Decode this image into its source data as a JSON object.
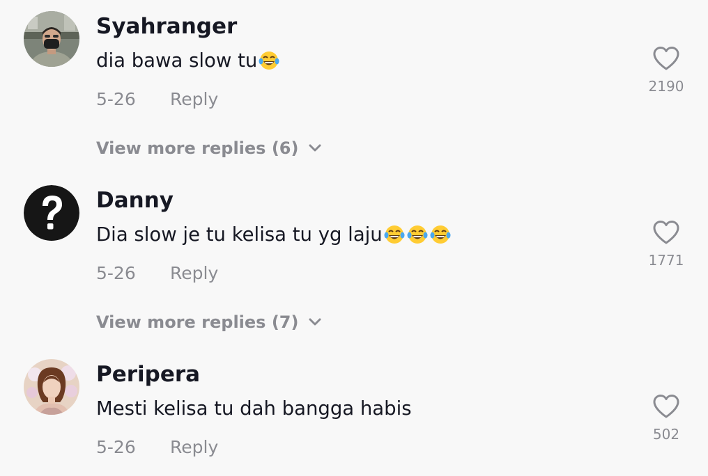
{
  "comments": [
    {
      "username": "Syahranger",
      "text": "dia bawa slow tu",
      "emoji_count": 1,
      "emoji_icon": "face-with-tears-of-joy-icon",
      "date": "5-26",
      "reply_label": "Reply",
      "likes": "2190",
      "view_more_label": "View more replies (6)"
    },
    {
      "username": "Danny",
      "text": "Dia slow je tu kelisa tu yg laju",
      "emoji_count": 3,
      "emoji_icon": "face-with-tears-of-joy-icon",
      "date": "5-26",
      "reply_label": "Reply",
      "likes": "1771",
      "view_more_label": "View more replies (7)"
    },
    {
      "username": "Peripera",
      "text": "Mesti kelisa tu dah bangga habis",
      "emoji_count": 0,
      "date": "5-26",
      "reply_label": "Reply",
      "likes": "502"
    }
  ],
  "colors": {
    "background": "#f8f8f8",
    "primary_text": "#161823",
    "secondary_text": "#8a8b91"
  }
}
